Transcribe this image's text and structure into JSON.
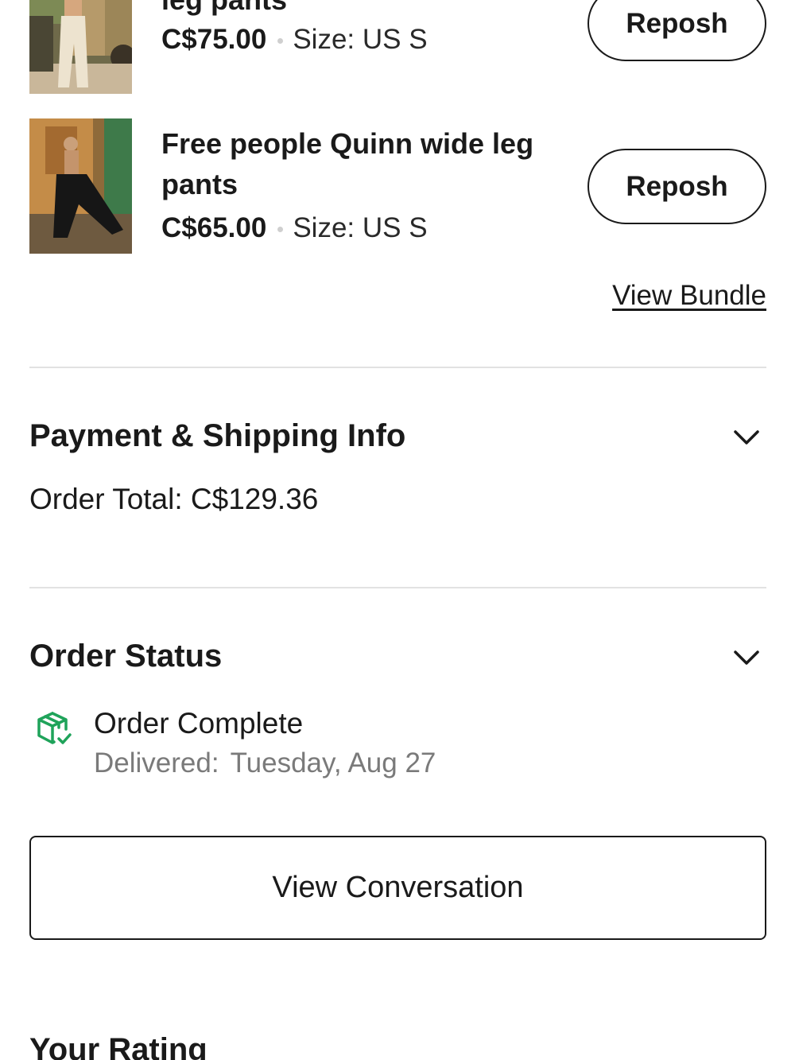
{
  "items": [
    {
      "title": "leg pants",
      "price": "C$75.00",
      "size": "Size: US S",
      "action_label": "Reposh"
    },
    {
      "title": "Free people Quinn wide leg pants",
      "price": "C$65.00",
      "size": "Size: US S",
      "action_label": "Reposh"
    }
  ],
  "bundle": {
    "link_label": "View Bundle"
  },
  "payment": {
    "title": "Payment & Shipping Info",
    "order_total": "Order Total: C$129.36"
  },
  "order_status": {
    "title": "Order Status",
    "status": "Order Complete",
    "delivered_label": "Delivered:",
    "delivered_date": "Tuesday, Aug 27",
    "icon": "package-check-icon",
    "icon_color": "#1fa35a"
  },
  "conversation": {
    "button_label": "View Conversation"
  },
  "rating": {
    "title": "Your Rating"
  }
}
